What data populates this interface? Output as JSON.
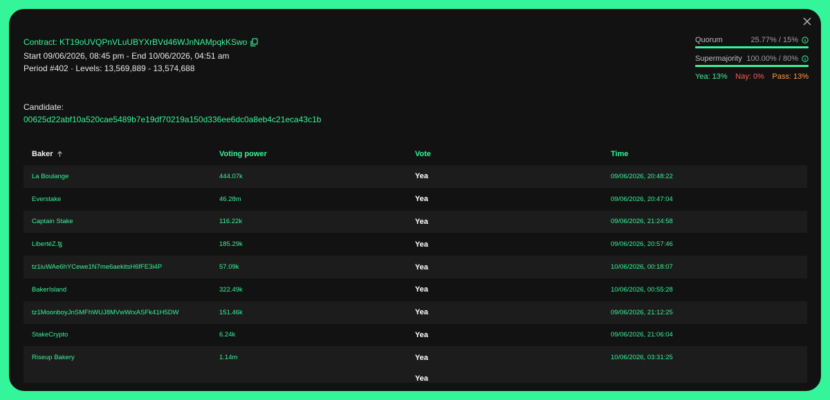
{
  "header": {
    "contract_label": "Contract: KT19oUVQPnVLuUBYXrBVd46WJnNAMpqkKSwo",
    "period_dates": "Start 09/06/2026, 08:45 pm - End 10/06/2026, 04:51 am",
    "period_levels": "Period #402 · Levels: 13,569,889 - 13,574,688"
  },
  "candidate": {
    "label": "Candidate:",
    "hash": "00625d22abf10a520cae5489b7e19df70219a150d336ee6dc0a8eb4c21eca43c1b"
  },
  "stats": {
    "quorum_label": "Quorum",
    "quorum_value": "25.77% / 15%",
    "supermajority_label": "Supermajority",
    "supermajority_value": "100.00% / 80%",
    "yea": "Yea: 13%",
    "nay": "Nay: 0%",
    "pass": "Pass: 13%"
  },
  "table": {
    "headers": {
      "baker": "Baker",
      "power": "Voting power",
      "vote": "Vote",
      "time": "Time"
    },
    "rows": [
      {
        "baker": "La Boulange",
        "power": "444.07k",
        "vote": "Yea",
        "time": "09/06/2026, 20:48:22"
      },
      {
        "baker": "Everstake",
        "power": "46.28m",
        "vote": "Yea",
        "time": "09/06/2026, 20:47:04"
      },
      {
        "baker": "Captain Stake",
        "power": "116.22k",
        "vote": "Yea",
        "time": "09/06/2026, 21:24:58"
      },
      {
        "baker": "LibertéZ.ꜩ",
        "power": "185.29k",
        "vote": "Yea",
        "time": "09/06/2026, 20:57:46"
      },
      {
        "baker": "tz1iuWAe6hYCewe1N7me6aekitsH6fFE3i4P",
        "power": "57.09k",
        "vote": "Yea",
        "time": "10/06/2026, 00:18:07"
      },
      {
        "baker": "BakerIsland",
        "power": "322.49k",
        "vote": "Yea",
        "time": "10/06/2026, 00:55:28"
      },
      {
        "baker": "tz1MoonboyJnSMFhWUJ8MVwWrxASFk41H5DW",
        "power": "151.46k",
        "vote": "Yea",
        "time": "09/06/2026, 21:12:25"
      },
      {
        "baker": "StakeCrypto",
        "power": "6.24k",
        "vote": "Yea",
        "time": "09/06/2026, 21:06:04"
      },
      {
        "baker": "Riseup Bakery",
        "power": "1.14m",
        "vote": "Yea",
        "time": "10/06/2026, 03:31:25"
      }
    ],
    "partial_row_vote": "Yea"
  },
  "colors": {
    "accent": "#35f59a",
    "background": "#121212",
    "row_alt": "#1c1c1c",
    "nay": "#ff5a4e",
    "pass": "#ff9e3d"
  },
  "icons": [
    "close-icon",
    "copy-icon",
    "info-icon",
    "sort-arrow-up-icon"
  ]
}
